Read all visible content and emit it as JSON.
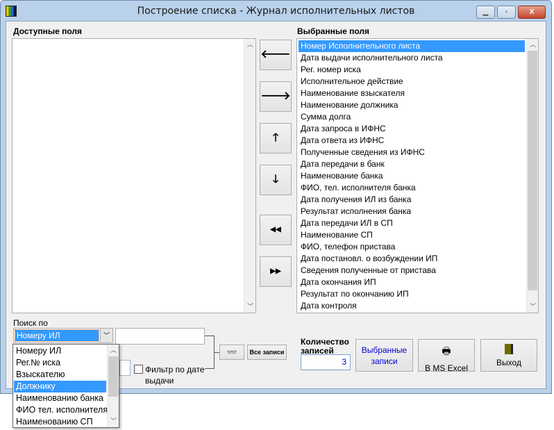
{
  "window": {
    "title": "Построение списка - Журнал исполнительных листов",
    "minimize": "▁",
    "maximize": "▫",
    "close": "X"
  },
  "available": {
    "label": "Доступные поля",
    "items": []
  },
  "selected": {
    "label": "Выбранные поля",
    "items": [
      "Номер Исполнительного листа",
      "Дата выдачи исполнительного листа",
      "Рег. номер иска",
      "Исполнительное действие",
      "Наименование взыскателя",
      "Наименование должника",
      "Сумма долга",
      "Дата запроса в ИФНС",
      "Дата ответа из ИФНС",
      "Полученные сведения из ИФНС",
      "Дата передачи в банк",
      "Наименование банка",
      "ФИО, тел. исполнителя банка",
      "Дата получения ИЛ из банка",
      "Результат исполнения банка",
      "Дата передачи ИЛ в СП",
      "Наименование СП",
      "ФИО, телефон пристава",
      "Дата постановл. о возбуждении ИП",
      "Сведения полученные от пристава",
      "Дата окончания ИП",
      "Результат по окончанию ИП",
      "Дата контроля"
    ],
    "selected_index": 0
  },
  "move_buttons": {
    "remove": "🡐",
    "add": "🡒",
    "up": "🡑",
    "down": "🡓",
    "remove_all": "◀◀",
    "add_all": "▶▶"
  },
  "search": {
    "label": "Поиск по",
    "selected": "Номеру ИЛ",
    "value": "",
    "options": [
      "Номеру ИЛ",
      "Рег.№ иска",
      "Взыскателю",
      "Должнику",
      "Наименованию банка",
      "ФИО тел. исполнителя",
      "Наименованию СП"
    ],
    "highlighted_index": 3
  },
  "filter": {
    "label": "Фильтр по дате выдачи",
    "checked": false
  },
  "find_button": "👓",
  "all_records_button": "Все записи",
  "count": {
    "label": "Количество записей",
    "value": "3"
  },
  "buttons": {
    "selected_records": "Выбранные записи",
    "excel": "В MS Excel",
    "exit": "Выход"
  }
}
